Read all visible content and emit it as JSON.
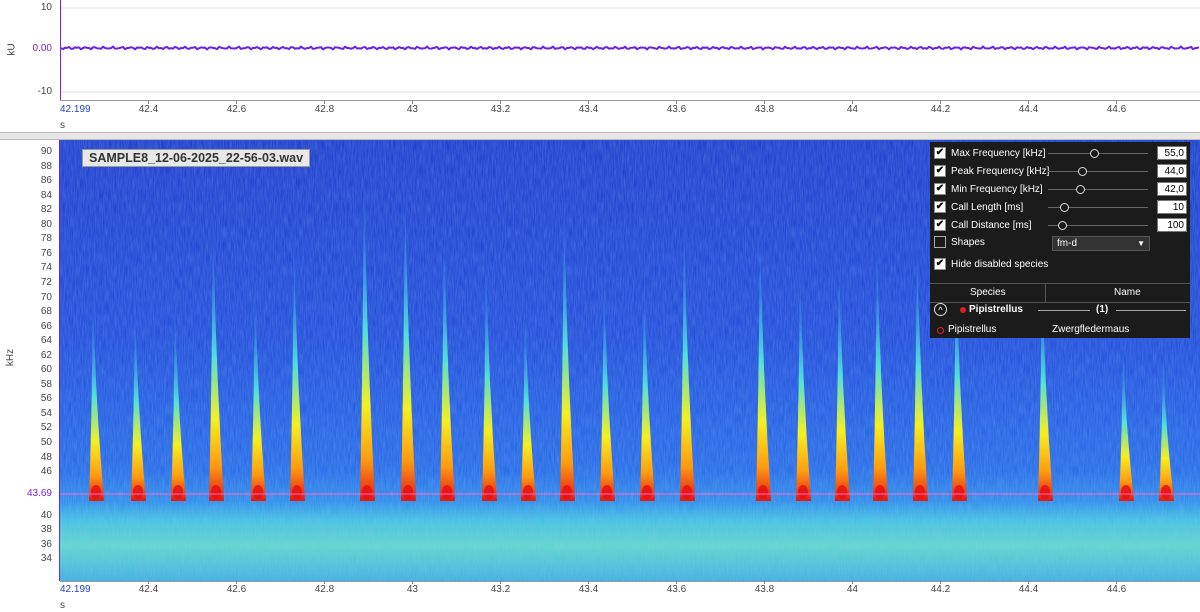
{
  "waveform": {
    "y_unit": "kU",
    "y_ticks": [
      "10",
      "0.00",
      "-10"
    ],
    "x_unit": "s",
    "x_start": "42.199",
    "x_ticks": [
      "42.4",
      "42.6",
      "42.8",
      "43",
      "43.2",
      "43.4",
      "43.6",
      "43.8",
      "44",
      "44.2",
      "44.4",
      "44.6"
    ],
    "trace_color": "#6a1fe6"
  },
  "spectrogram": {
    "file_name": "SAMPLE8_12-06-2025_22-56-03.wav",
    "y_unit": "kHz",
    "y_ticks": [
      "90",
      "88",
      "86",
      "84",
      "82",
      "80",
      "78",
      "76",
      "74",
      "72",
      "70",
      "68",
      "66",
      "64",
      "62",
      "60",
      "58",
      "56",
      "54",
      "52",
      "50",
      "48",
      "46",
      "40",
      "38",
      "36",
      "34"
    ],
    "y_marker": "43.69",
    "marker_color": "#ff66cc",
    "x_unit": "s",
    "x_start": "42.199",
    "x_ticks": [
      "42.4",
      "42.6",
      "42.8",
      "43",
      "43.2",
      "43.4",
      "43.6",
      "43.8",
      "44",
      "44.2",
      "44.4",
      "44.6"
    ]
  },
  "panel": {
    "params": [
      {
        "label": "Max Frequency [kHz]",
        "value": "55,0",
        "checked": true,
        "level": 0.42
      },
      {
        "label": "Peak Frequency [kHz]",
        "value": "44,0",
        "checked": true,
        "level": 0.3
      },
      {
        "label": "Min Frequency [kHz]",
        "value": "42,0",
        "checked": true,
        "level": 0.28
      },
      {
        "label": "Call Length [ms]",
        "value": "10",
        "checked": true,
        "level": 0.12
      },
      {
        "label": "Call Distance [ms]",
        "value": "100",
        "checked": true,
        "level": 0.1
      }
    ],
    "shapes": {
      "label": "Shapes",
      "checked": false,
      "value": "fm-d"
    },
    "hide_disabled": {
      "label": "Hide disabled species",
      "checked": true
    },
    "table_headers": {
      "species": "Species",
      "name": "Name"
    },
    "group": {
      "label": "Pipistrellus",
      "count": "(1)",
      "color": "#e02020"
    },
    "rows": [
      {
        "species": "Pipistrellus",
        "name": "Zwergfledermaus",
        "color": "#e02020"
      }
    ]
  }
}
